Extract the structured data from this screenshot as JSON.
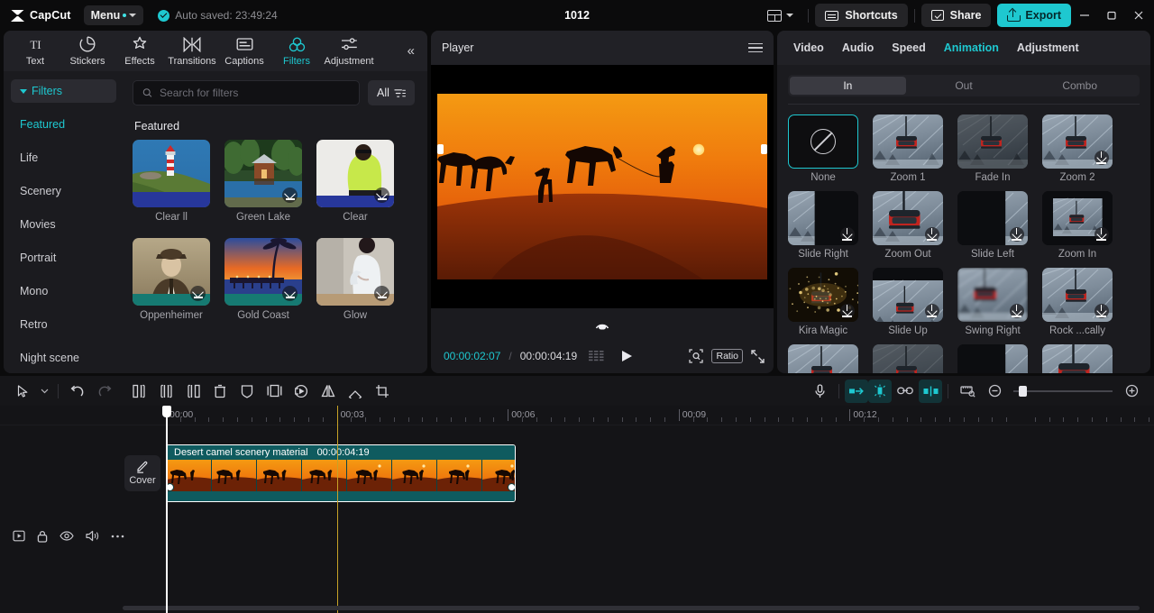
{
  "titlebar": {
    "brand": "CapCut",
    "menu_label": "Menu",
    "autosave": "Auto saved: 23:49:24",
    "project_title": "1012",
    "shortcuts_label": "Shortcuts",
    "share_label": "Share",
    "export_label": "Export",
    "accent": "#1ec8d0"
  },
  "left_panel": {
    "tabs": [
      {
        "label": "Text",
        "icon": "text-icon",
        "active": false
      },
      {
        "label": "Stickers",
        "icon": "sticker-icon",
        "active": false
      },
      {
        "label": "Effects",
        "icon": "effects-icon",
        "active": false
      },
      {
        "label": "Transitions",
        "icon": "transitions-icon",
        "active": false
      },
      {
        "label": "Captions",
        "icon": "captions-icon",
        "active": false
      },
      {
        "label": "Filters",
        "icon": "filters-icon",
        "active": true
      },
      {
        "label": "Adjustment",
        "icon": "adjustment-icon",
        "active": false
      }
    ],
    "collapse_icon": "chevron-double-left-icon",
    "category_header": "Filters",
    "categories": [
      {
        "label": "Featured",
        "active": true
      },
      {
        "label": "Life",
        "active": false
      },
      {
        "label": "Scenery",
        "active": false
      },
      {
        "label": "Movies",
        "active": false
      },
      {
        "label": "Portrait",
        "active": false
      },
      {
        "label": "Mono",
        "active": false
      },
      {
        "label": "Retro",
        "active": false
      },
      {
        "label": "Night scene",
        "active": false
      }
    ],
    "search_placeholder": "Search for filters",
    "search_value": "",
    "filter_button": "All",
    "section_title": "Featured",
    "filters": [
      {
        "name": "Clear ll",
        "download": false,
        "thumb": "lighthouse"
      },
      {
        "name": "Green Lake",
        "download": true,
        "thumb": "lake-cabin"
      },
      {
        "name": "Clear",
        "download": true,
        "thumb": "model-green"
      },
      {
        "name": "Oppenheimer",
        "download": true,
        "thumb": "portrait-sepia"
      },
      {
        "name": "Gold Coast",
        "download": true,
        "thumb": "pier-sunset"
      },
      {
        "name": "Glow",
        "download": true,
        "thumb": "dress-white"
      }
    ]
  },
  "player": {
    "title": "Player",
    "menu_icon": "hamburger-icon",
    "current_time": "00:00:02:07",
    "separator": "/",
    "total_time": "00:00:04:19",
    "ratio_label": "Ratio",
    "icons": [
      "rotate-icon",
      "frames-icon",
      "play-icon",
      "zoom-fit-icon",
      "fullscreen-icon"
    ]
  },
  "right_panel": {
    "tabs": [
      {
        "label": "Video",
        "active": false
      },
      {
        "label": "Audio",
        "active": false
      },
      {
        "label": "Speed",
        "active": false
      },
      {
        "label": "Animation",
        "active": true
      },
      {
        "label": "Adjustment",
        "active": false
      }
    ],
    "segments": [
      {
        "label": "In",
        "active": true
      },
      {
        "label": "Out",
        "active": false
      },
      {
        "label": "Combo",
        "active": false
      }
    ],
    "animations": [
      {
        "name": "None",
        "selected": true,
        "download": false,
        "thumb": "none"
      },
      {
        "name": "Zoom 1",
        "selected": false,
        "download": false,
        "thumb": "gondola"
      },
      {
        "name": "Fade In",
        "selected": false,
        "download": false,
        "thumb": "gondola-dark"
      },
      {
        "name": "Zoom 2",
        "selected": false,
        "download": true,
        "thumb": "gondola"
      },
      {
        "name": "Slide Right",
        "selected": false,
        "download": true,
        "thumb": "slide-right"
      },
      {
        "name": "Zoom Out",
        "selected": false,
        "download": true,
        "thumb": "gondola-big"
      },
      {
        "name": "Slide Left",
        "selected": false,
        "download": true,
        "thumb": "slide-left"
      },
      {
        "name": "Zoom In",
        "selected": false,
        "download": true,
        "thumb": "gondola-small"
      },
      {
        "name": "Kira Magic",
        "selected": false,
        "download": true,
        "thumb": "sparkle"
      },
      {
        "name": "Slide Up",
        "selected": false,
        "download": true,
        "thumb": "slide-up"
      },
      {
        "name": "Swing Right",
        "selected": false,
        "download": true,
        "thumb": "gondola-blur"
      },
      {
        "name": "Rock ...cally",
        "selected": false,
        "download": true,
        "thumb": "gondola"
      },
      {
        "name": "",
        "selected": false,
        "download": false,
        "thumb": "gondola"
      },
      {
        "name": "",
        "selected": false,
        "download": false,
        "thumb": "gondola-dark"
      },
      {
        "name": "",
        "selected": false,
        "download": false,
        "thumb": "slide-left"
      },
      {
        "name": "",
        "selected": false,
        "download": false,
        "thumb": "gondola-big"
      }
    ]
  },
  "toolbar": {
    "left_icons": [
      "select-arrow-icon",
      "chevron-down-icon",
      "undo-icon",
      "redo-icon",
      "split-left-icon",
      "split-icon",
      "split-right-icon",
      "delete-icon",
      "mask-icon",
      "crop-frame-icon",
      "speed-icon",
      "mirror-icon",
      "rotate-shape-icon",
      "crop-icon"
    ],
    "right_icons": [
      "microphone-icon",
      "auto-snap-icon",
      "magnet-icon",
      "link-icon",
      "keyframe-icon",
      "preview-ruler-icon",
      "zoom-out-icon",
      "zoom-slider",
      "zoom-in-icon"
    ]
  },
  "timeline": {
    "ruler_labels": [
      "00:00",
      "00:03",
      "00:06",
      "00:09",
      "00:12"
    ],
    "track_header_icons": [
      "video-track-icon",
      "lock-icon",
      "eye-icon",
      "volume-icon",
      "more-icon"
    ],
    "cover_label": "Cover",
    "cover_icon": "pencil-icon",
    "clip": {
      "name": "Desert camel scenery material",
      "duration": "00:00:04:19"
    }
  }
}
